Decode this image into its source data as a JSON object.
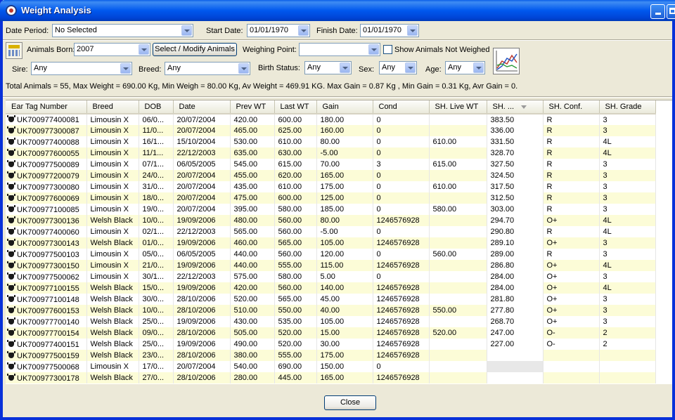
{
  "window": {
    "title": "Weight Analysis"
  },
  "filters": {
    "date_period_label": "Date Period:",
    "date_period_value": "No Selected",
    "start_date_label": "Start Date:",
    "start_date_value": "01/01/1970",
    "finish_date_label": "Finish Date:",
    "finish_date_value": "01/01/1970",
    "animals_born_label": "Animals Born:",
    "animals_born_value": "2007",
    "select_modify_label": "Select / Modify Animals",
    "weighing_point_label": "Weighing Point:",
    "weighing_point_value": "",
    "show_not_weighed_label": "Show Animals Not Weighed",
    "sire_label": "Sire:",
    "sire_value": "Any",
    "breed_label": "Breed:",
    "breed_value": "Any",
    "birth_status_label": "Birth Status:",
    "birth_status_value": "Any",
    "sex_label": "Sex:",
    "sex_value": "Any",
    "age_label": "Age:",
    "age_value": "Any"
  },
  "summary": "Total Animals = 55, Max Weight = 690.00 Kg, Min Weigh = 80.00 Kg, Av Weight = 469.91 KG. Max Gain = 0.87 Kg , Min Gain = 0.31 Kg, Avr Gain = 0.",
  "table": {
    "columns": [
      "Ear Tag Number",
      "Breed",
      "DOB",
      "Date",
      "Prev WT",
      "Last WT",
      "Gain",
      "Cond",
      "SH. Live WT",
      "SH. ...",
      "SH. Conf.",
      "SH. Grade"
    ],
    "rows": [
      [
        "UK700977400081",
        "Limousin X",
        "06/0...",
        "20/07/2004",
        "420.00",
        "600.00",
        "180.00",
        "0",
        "",
        "383.50",
        "R",
        "3"
      ],
      [
        "UK700977300087",
        "Limousin X",
        "11/0...",
        "20/07/2004",
        "465.00",
        "625.00",
        "160.00",
        "0",
        "",
        "336.00",
        "R",
        "3"
      ],
      [
        "UK700977400088",
        "Limousin X",
        "16/1...",
        "15/10/2004",
        "530.00",
        "610.00",
        "80.00",
        "0",
        "610.00",
        "331.50",
        "R",
        "4L"
      ],
      [
        "UK700977600055",
        "Limousin X",
        "11/1...",
        "22/12/2003",
        "635.00",
        "630.00",
        "-5.00",
        "0",
        "",
        "328.70",
        "R",
        "4L"
      ],
      [
        "UK700977500089",
        "Limousin X",
        "07/1...",
        "06/05/2005",
        "545.00",
        "615.00",
        "70.00",
        "3",
        "615.00",
        "327.50",
        "R",
        "3"
      ],
      [
        "UK700977200079",
        "Limousin X",
        "24/0...",
        "20/07/2004",
        "455.00",
        "620.00",
        "165.00",
        "0",
        "",
        "324.50",
        "R",
        "3"
      ],
      [
        "UK700977300080",
        "Limousin X",
        "31/0...",
        "20/07/2004",
        "435.00",
        "610.00",
        "175.00",
        "0",
        "610.00",
        "317.50",
        "R",
        "3"
      ],
      [
        "UK700977600069",
        "Limousin X",
        "18/0...",
        "20/07/2004",
        "475.00",
        "600.00",
        "125.00",
        "0",
        "",
        "312.50",
        "R",
        "3"
      ],
      [
        "UK700977100085",
        "Limousin X",
        "19/0...",
        "20/07/2004",
        "395.00",
        "580.00",
        "185.00",
        "0",
        "580.00",
        "303.00",
        "R",
        "3"
      ],
      [
        "UK700977300136",
        "Welsh Black",
        "10/0...",
        "19/09/2006",
        "480.00",
        "560.00",
        "80.00",
        "1246576928",
        "",
        "294.70",
        "O+",
        "4L"
      ],
      [
        "UK700977400060",
        "Limousin X",
        "02/1...",
        "22/12/2003",
        "565.00",
        "560.00",
        "-5.00",
        "0",
        "",
        "290.80",
        "R",
        "4L"
      ],
      [
        "UK700977300143",
        "Welsh Black",
        "01/0...",
        "19/09/2006",
        "460.00",
        "565.00",
        "105.00",
        "1246576928",
        "",
        "289.10",
        "O+",
        "3"
      ],
      [
        "UK700977500103",
        "Limousin X",
        "05/0...",
        "06/05/2005",
        "440.00",
        "560.00",
        "120.00",
        "0",
        "560.00",
        "289.00",
        "R",
        "3"
      ],
      [
        "UK700977300150",
        "Limousin X",
        "21/0...",
        "19/09/2006",
        "440.00",
        "555.00",
        "115.00",
        "1246576928",
        "",
        "286.80",
        "O+",
        "4L"
      ],
      [
        "UK700977500062",
        "Limousin X",
        "30/1...",
        "22/12/2003",
        "575.00",
        "580.00",
        "5.00",
        "0",
        "",
        "284.00",
        "O+",
        "3"
      ],
      [
        "UK700977100155",
        "Welsh Black",
        "15/0...",
        "19/09/2006",
        "420.00",
        "560.00",
        "140.00",
        "1246576928",
        "",
        "284.00",
        "O+",
        "4L"
      ],
      [
        "UK700977100148",
        "Welsh Black",
        "30/0...",
        "28/10/2006",
        "520.00",
        "565.00",
        "45.00",
        "1246576928",
        "",
        "281.80",
        "O+",
        "3"
      ],
      [
        "UK700977600153",
        "Welsh Black",
        "10/0...",
        "28/10/2006",
        "510.00",
        "550.00",
        "40.00",
        "1246576928",
        "550.00",
        "277.80",
        "O+",
        "3"
      ],
      [
        "UK700977700140",
        "Welsh Black",
        "25/0...",
        "19/09/2006",
        "430.00",
        "535.00",
        "105.00",
        "1246576928",
        "",
        "268.70",
        "O+",
        "3"
      ],
      [
        "UK700977700154",
        "Welsh Black",
        "09/0...",
        "28/10/2006",
        "505.00",
        "520.00",
        "15.00",
        "1246576928",
        "520.00",
        "247.00",
        "O-",
        "2"
      ],
      [
        "UK700977400151",
        "Welsh Black",
        "25/0...",
        "19/09/2006",
        "490.00",
        "520.00",
        "30.00",
        "1246576928",
        "",
        "227.00",
        "O-",
        "2"
      ],
      [
        "UK700977500159",
        "Welsh Black",
        "23/0...",
        "28/10/2006",
        "380.00",
        "555.00",
        "175.00",
        "1246576928",
        "",
        "",
        "",
        ""
      ],
      [
        "UK700977500068",
        "Limousin X",
        "17/0...",
        "20/07/2004",
        "540.00",
        "690.00",
        "150.00",
        "0",
        "",
        "",
        "",
        ""
      ],
      [
        "UK700977300178",
        "Welsh Black",
        "27/0...",
        "28/10/2006",
        "280.00",
        "445.00",
        "165.00",
        "1246576928",
        "",
        "",
        "",
        ""
      ]
    ]
  },
  "footer": {
    "close_label": "Close"
  },
  "colors": {
    "title_bar": "#0058ee",
    "row_alt": "#fcfcd7",
    "window_bg": "#ece9d8"
  }
}
